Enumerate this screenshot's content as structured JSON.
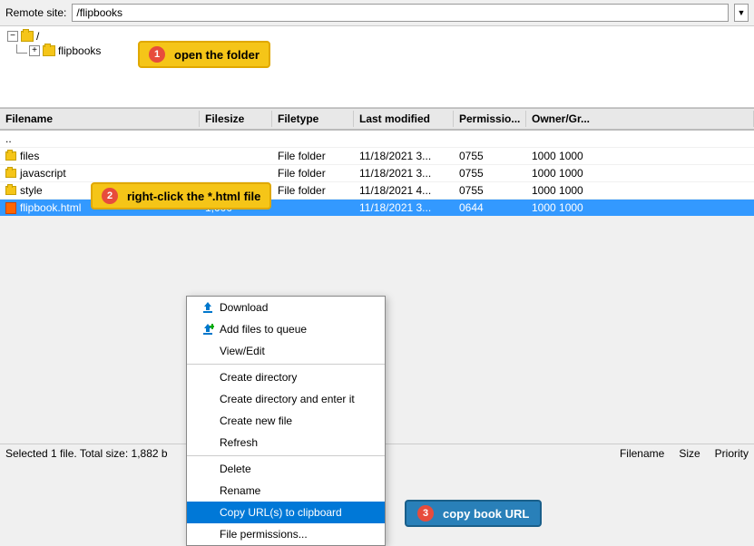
{
  "remote_site": {
    "label": "Remote site:",
    "value": "/flipbooks"
  },
  "tree": {
    "root_label": "/",
    "child_label": "flipbooks"
  },
  "callout1": {
    "step": "1",
    "text": "open the folder"
  },
  "callout2": {
    "step": "2",
    "text": "right-click the *.html file"
  },
  "callout3": {
    "step": "3",
    "text": "copy book URL"
  },
  "table": {
    "headers": [
      "Filename",
      "Filesize",
      "Filetype",
      "Last modified",
      "Permissio...",
      "Owner/Gr..."
    ],
    "rows": [
      {
        "name": "..",
        "size": "",
        "type": "",
        "modified": "",
        "perms": "",
        "owner": "",
        "icon": "dotdot"
      },
      {
        "name": "files",
        "size": "",
        "type": "File folder",
        "modified": "11/18/2021 3...",
        "perms": "0755",
        "owner": "1000 1000",
        "icon": "folder"
      },
      {
        "name": "javascript",
        "size": "",
        "type": "File folder",
        "modified": "11/18/2021 3...",
        "perms": "0755",
        "owner": "1000 1000",
        "icon": "folder"
      },
      {
        "name": "style",
        "size": "",
        "type": "File folder",
        "modified": "11/18/2021 4...",
        "perms": "0755",
        "owner": "1000 1000",
        "icon": "folder"
      },
      {
        "name": "flipbook.html",
        "size": "1,000",
        "type": "",
        "modified": "11/18/2021 3...",
        "perms": "0644",
        "owner": "1000 1000",
        "icon": "html",
        "selected": true
      }
    ]
  },
  "context_menu": {
    "items": [
      {
        "label": "Download",
        "has_icon": true,
        "icon_type": "arrow-down"
      },
      {
        "label": "Add files to queue",
        "has_icon": true,
        "icon_type": "arrow-add"
      },
      {
        "label": "View/Edit",
        "has_icon": false
      },
      {
        "separator": true
      },
      {
        "label": "Create directory",
        "has_icon": false
      },
      {
        "label": "Create directory and enter it",
        "has_icon": false
      },
      {
        "label": "Create new file",
        "has_icon": false
      },
      {
        "label": "Refresh",
        "has_icon": false
      },
      {
        "separator": true
      },
      {
        "label": "Delete",
        "has_icon": false
      },
      {
        "label": "Rename",
        "has_icon": false
      },
      {
        "label": "Copy URL(s) to clipboard",
        "has_icon": false,
        "highlighted": true
      },
      {
        "label": "File permissions...",
        "has_icon": false
      }
    ]
  },
  "status_bar": {
    "text": "Selected 1 file. Total size: 1,882 b"
  },
  "queue_header": {
    "columns": [
      "Filename",
      "Size",
      "Priority"
    ]
  }
}
